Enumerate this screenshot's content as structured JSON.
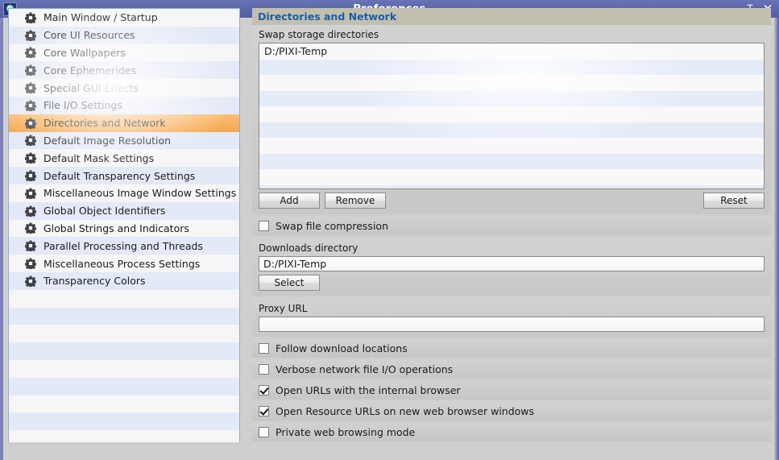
{
  "window": {
    "title": "Preferences",
    "icon": "app-globe-icon",
    "collapse_glyph": "⌶",
    "close_glyph": "✕",
    "titlebar_color": "#5b67ab"
  },
  "sidebar": {
    "selected_index": 6,
    "items": [
      {
        "icon": "gear-icon",
        "label": "Main Window / Startup"
      },
      {
        "icon": "gear-icon",
        "label": "Core UI Resources"
      },
      {
        "icon": "gear-icon",
        "label": "Core Wallpapers"
      },
      {
        "icon": "gear-icon",
        "label": "Core Ephemerides"
      },
      {
        "icon": "gear-icon",
        "label": "Special GUI Effects"
      },
      {
        "icon": "gear-icon",
        "label": "File I/O Settings"
      },
      {
        "icon": "gear-icon",
        "label": "Directories and Network"
      },
      {
        "icon": "gear-icon",
        "label": "Default Image Resolution"
      },
      {
        "icon": "gear-icon",
        "label": "Default Mask Settings"
      },
      {
        "icon": "gear-icon",
        "label": "Default Transparency Settings"
      },
      {
        "icon": "gear-icon",
        "label": "Miscellaneous Image Window Settings"
      },
      {
        "icon": "gear-icon",
        "label": "Global Object Identifiers"
      },
      {
        "icon": "gear-icon",
        "label": "Global Strings and Indicators"
      },
      {
        "icon": "gear-icon",
        "label": "Parallel Processing and Threads"
      },
      {
        "icon": "gear-icon",
        "label": "Miscellaneous Process Settings"
      },
      {
        "icon": "gear-icon",
        "label": "Transparency Colors"
      }
    ],
    "selection_color": "#f5a74f"
  },
  "panel": {
    "header": "Directories and Network",
    "header_text_color": "#1a5fa8",
    "swap_storage": {
      "label": "Swap storage directories",
      "entries": [
        "D:/PIXI-Temp"
      ],
      "buttons": {
        "add": "Add",
        "remove": "Remove",
        "reset": "Reset"
      }
    },
    "swap_compression": {
      "label": "Swap file compression",
      "checked": false
    },
    "downloads": {
      "label": "Downloads directory",
      "value": "D:/PIXI-Temp",
      "placeholder": "",
      "select_button": "Select"
    },
    "proxy": {
      "label": "Proxy URL",
      "value": "",
      "placeholder": ""
    },
    "options": [
      {
        "label": "Follow download locations",
        "checked": false
      },
      {
        "label": "Verbose network file I/O operations",
        "checked": false
      },
      {
        "label": "Open URLs with the internal browser",
        "checked": true
      },
      {
        "label": "Open Resource URLs on new web browser windows",
        "checked": true
      },
      {
        "label": "Private web browsing mode",
        "checked": false
      }
    ]
  }
}
